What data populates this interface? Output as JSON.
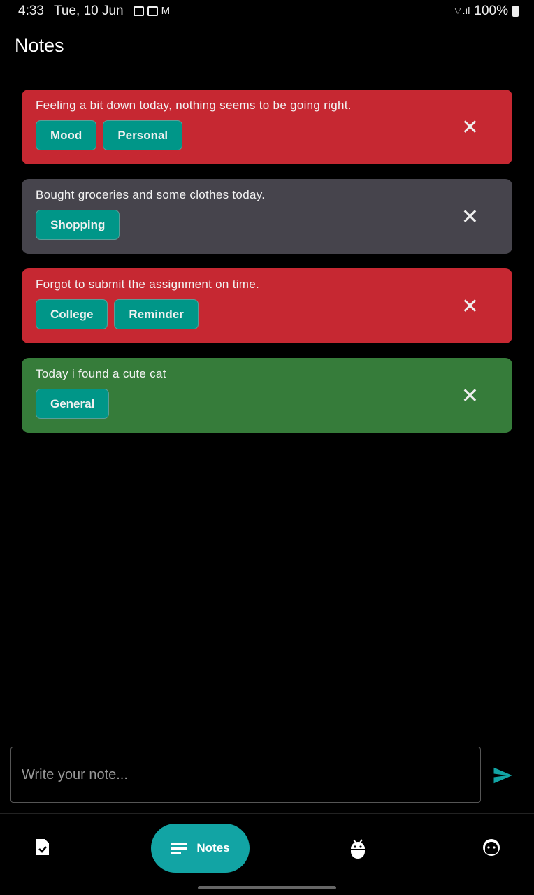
{
  "status_bar": {
    "time": "4:33",
    "date": "Tue, 10 Jun",
    "battery": "100%"
  },
  "header": {
    "title": "Notes"
  },
  "notes": [
    {
      "text": "Feeling a bit down today, nothing seems to be going right.",
      "tags": [
        "Mood",
        "Personal"
      ],
      "color": "#c62832"
    },
    {
      "text": "Bought groceries and some clothes today.",
      "tags": [
        "Shopping"
      ],
      "color": "#46444c"
    },
    {
      "text": "Forgot to submit the assignment on time.",
      "tags": [
        "College",
        "Reminder"
      ],
      "color": "#c62832"
    },
    {
      "text": "Today i found a cute cat",
      "tags": [
        "General"
      ],
      "color": "#367c3a"
    }
  ],
  "composer": {
    "placeholder": "Write your note..."
  },
  "nav": {
    "active_label": "Notes"
  },
  "colors": {
    "accent": "#12a4a4",
    "chip": "#009688"
  }
}
